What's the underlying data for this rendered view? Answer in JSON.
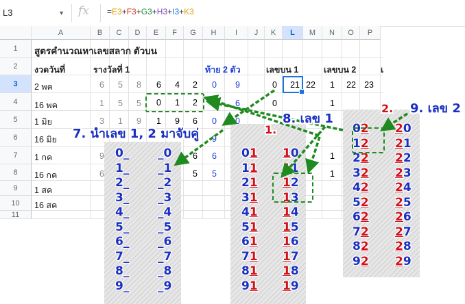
{
  "formula_bar": {
    "cell_ref": "L3",
    "fx": "fx",
    "formula_parts": [
      {
        "text": "=",
        "color": "#333333"
      },
      {
        "text": "E3",
        "color": "#e0a000"
      },
      {
        "text": "+",
        "color": "#333333"
      },
      {
        "text": "F3",
        "color": "#d93025"
      },
      {
        "text": "+",
        "color": "#333333"
      },
      {
        "text": "G3",
        "color": "#1e8e3e"
      },
      {
        "text": "+",
        "color": "#333333"
      },
      {
        "text": "H3",
        "color": "#7b3fb5"
      },
      {
        "text": "+",
        "color": "#333333"
      },
      {
        "text": "I3",
        "color": "#1a73e8"
      },
      {
        "text": "+",
        "color": "#333333"
      },
      {
        "text": "K3",
        "color": "#e0a000"
      }
    ]
  },
  "columns": [
    "A",
    "B",
    "C",
    "D",
    "E",
    "F",
    "G",
    "H",
    "I",
    "J",
    "K",
    "L",
    "M",
    "N",
    "O",
    "P"
  ],
  "rows": [
    "1",
    "2",
    "3",
    "4",
    "5",
    "6",
    "7",
    "8",
    "9",
    "10",
    "11"
  ],
  "sheet": {
    "A1": "สูตรคำนวณหาเลขสลาก ตัวบน",
    "A2": "งวดวันที่",
    "B2": "รางวัลที่ 1",
    "H2": "ท้าย 2 ตัว",
    "K2": "เลขบน 1",
    "N2": "เลขบน 2",
    "A3": "2 พค",
    "A4": "16 พค",
    "A5": "1 มิย",
    "A6": "16 มิย",
    "A7": "1 กค",
    "A8": "16 กค",
    "A9": "1 สค",
    "A10": "16 สค",
    "row3": {
      "B": "6",
      "C": "5",
      "D": "8",
      "E": "6",
      "F": "4",
      "G": "2",
      "H": "0",
      "I": "9",
      "K": "0",
      "L": "21",
      "M": "22",
      "N": "1",
      "O": "22",
      "P": "23"
    },
    "row4": {
      "B": "1",
      "C": "5",
      "D": "5",
      "E": "0",
      "F": "1",
      "G": "2",
      "I": "6",
      "K": "0",
      "N": "1"
    },
    "row5": {
      "B": "3",
      "C": "1",
      "D": "9",
      "E": "1",
      "F": "9",
      "G": "6",
      "H": "0",
      "I": "0"
    },
    "row6": {
      "H": "9"
    },
    "row7": {
      "B": "9",
      "F": "7",
      "G": "6",
      "H": "6",
      "N": "1"
    },
    "row8": {
      "B": "6",
      "F": "5",
      "G": "5",
      "H": "5",
      "N": "1"
    }
  },
  "annotations": {
    "label1": "1.",
    "label2": "2.",
    "label7": "7. นำเลข 1, 2 มาจับคู่",
    "label8": "8. เลข 1",
    "label9": "9. เลข 2",
    "box_digits": [
      "0",
      "1",
      "2"
    ]
  },
  "panel_left": {
    "col1": [
      "0_",
      "1_",
      "2_",
      "3_",
      "4_",
      "5_",
      "6_",
      "7_",
      "8_",
      "9_"
    ],
    "col2": [
      "_0",
      "_1",
      "_2",
      "_3",
      "_4",
      "_5",
      "_6",
      "_7",
      "_8",
      "_9"
    ]
  },
  "panel_mid": {
    "col1": [
      [
        "0",
        "1"
      ],
      [
        "1",
        "1"
      ],
      [
        "2",
        "1"
      ],
      [
        "3",
        "1"
      ],
      [
        "4",
        "1"
      ],
      [
        "5",
        "1"
      ],
      [
        "6",
        "1"
      ],
      [
        "7",
        "1"
      ],
      [
        "8",
        "1"
      ],
      [
        "9",
        "1"
      ]
    ],
    "col2": [
      [
        "1",
        "0"
      ],
      [
        "1",
        "1"
      ],
      [
        "1",
        "2"
      ],
      [
        "1",
        "3"
      ],
      [
        "1",
        "4"
      ],
      [
        "1",
        "5"
      ],
      [
        "1",
        "6"
      ],
      [
        "1",
        "7"
      ],
      [
        "1",
        "8"
      ],
      [
        "1",
        "9"
      ]
    ]
  },
  "panel_right": {
    "col1": [
      [
        "0",
        "2"
      ],
      [
        "1",
        "2"
      ],
      [
        "2",
        "2"
      ],
      [
        "3",
        "2"
      ],
      [
        "4",
        "2"
      ],
      [
        "5",
        "2"
      ],
      [
        "6",
        "2"
      ],
      [
        "7",
        "2"
      ],
      [
        "8",
        "2"
      ],
      [
        "9",
        "2"
      ]
    ],
    "col2": [
      [
        "2",
        "0"
      ],
      [
        "2",
        "1"
      ],
      [
        "2",
        "2"
      ],
      [
        "2",
        "3"
      ],
      [
        "2",
        "4"
      ],
      [
        "2",
        "5"
      ],
      [
        "2",
        "6"
      ],
      [
        "2",
        "7"
      ],
      [
        "2",
        "8"
      ],
      [
        "2",
        "9"
      ]
    ]
  }
}
